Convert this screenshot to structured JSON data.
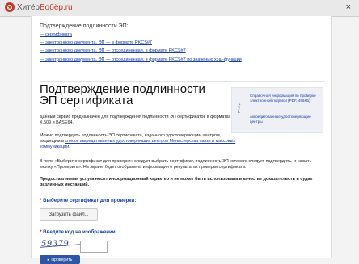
{
  "browser": {
    "logo_icon": "✪",
    "logo_prefix": "Хитёр",
    "logo_suffix": "Бобёр.ru",
    "close": "×"
  },
  "toc": {
    "title": "Подтверждение подлинности ЭП:",
    "items": [
      "— сертификата",
      "— электронного документа. ЭП — в формате PKCS#7",
      "— электронного документа. ЭП — отсоединенная, в формате PKCS#7",
      "— электронного документа. ЭП — отсоединенная, в формате PKCS#7 по значению хэш-функции"
    ]
  },
  "main": {
    "heading": "Подтверждение подлинности ЭП сертификата",
    "para1": "Данный сервис предназначен для подтверждения подлинности ЭП сертификатов в форматах X.509 и BASE64.",
    "para2_before": "Можно подтвердить подлинность ЭП сертификата, изданного удостоверяющим центром, входящим в ",
    "para2_link": "список аккредитованных удостоверяющих центров Министерства связи и массовых коммуникаций",
    "para2_after": ".",
    "para3": "В поле «Выберите сертификат для проверки» следует выбрать сертификат, подлинность ЭП которого следует подтвердить, и нажать кнопку «Проверить». На экране будет отображена информация о результатах проверки сертификата.",
    "notice": "Предоставляемая услуга носит информационный характер и не может быть использована в качестве доказательств в судах различных инстанций."
  },
  "sidebar": {
    "info_icon": "i",
    "link1": "Справочная информация по проверке электронной подписи (PDF, 496КБ)",
    "link2": "Аккредитованные удостоверяющие центры"
  },
  "form": {
    "select_label": "Выберите сертификат для проверки:",
    "upload_button": "Загрузить файл...",
    "captcha_label": "Введите код на изображении:",
    "required_mark": "*",
    "captcha_text": "59379",
    "captcha_value": "",
    "check_button": "Проверить",
    "check_icon": "▸"
  }
}
